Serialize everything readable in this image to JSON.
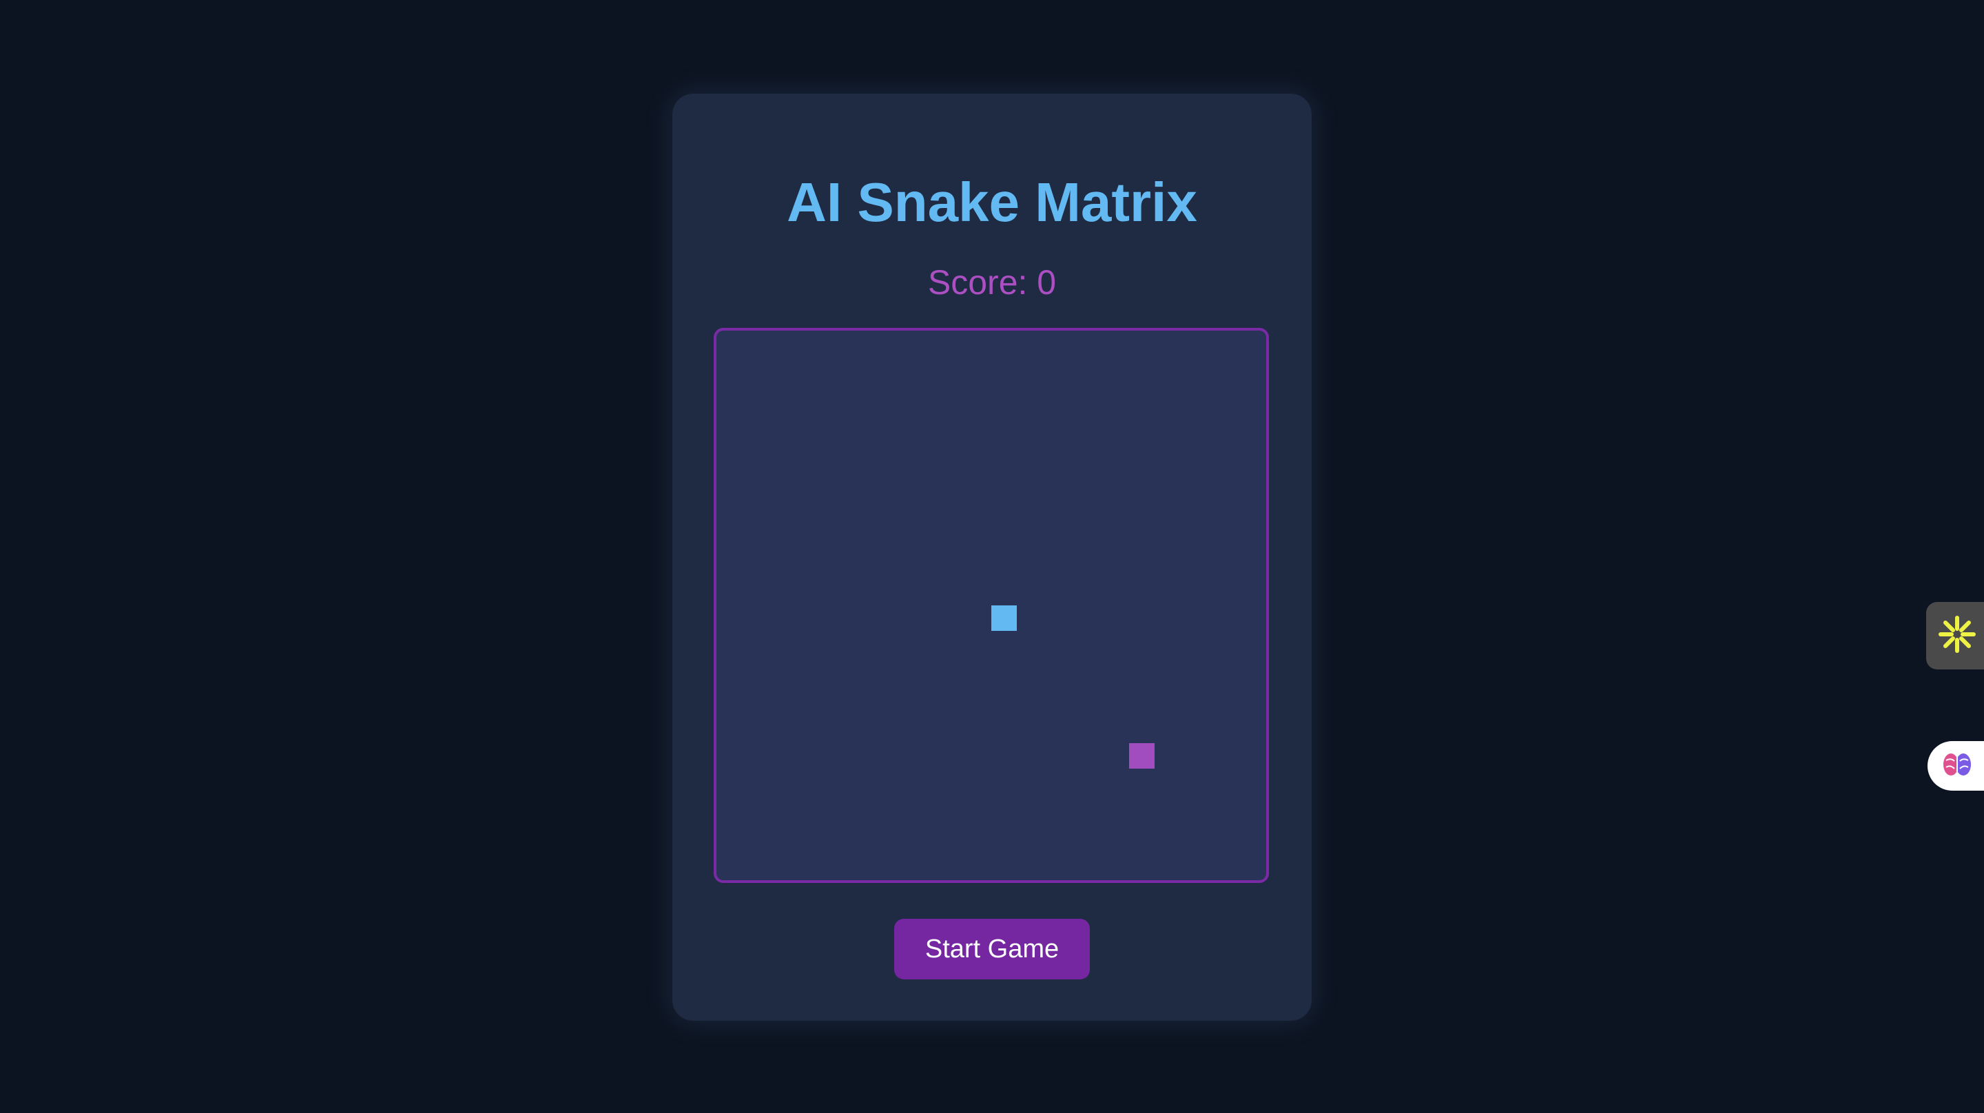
{
  "game": {
    "title": "AI Snake Matrix",
    "score_label": "Score: 0",
    "start_button_label": "Start Game"
  },
  "board": {
    "grid_size": 20,
    "snake": [
      {
        "col": 10,
        "row": 10
      }
    ],
    "food": {
      "col": 15,
      "row": 15
    }
  },
  "colors": {
    "background": "#0d1421",
    "card": "#1f2a43",
    "board": "#283357",
    "board_border": "#7b2aa6",
    "title": "#63b9f2",
    "score": "#ab4fc3",
    "snake": "#63b9f2",
    "food": "#a14cbf",
    "button": "#7527a2"
  },
  "extensions": [
    {
      "icon": "sparkle-burst-icon"
    },
    {
      "icon": "brain-icon"
    }
  ]
}
